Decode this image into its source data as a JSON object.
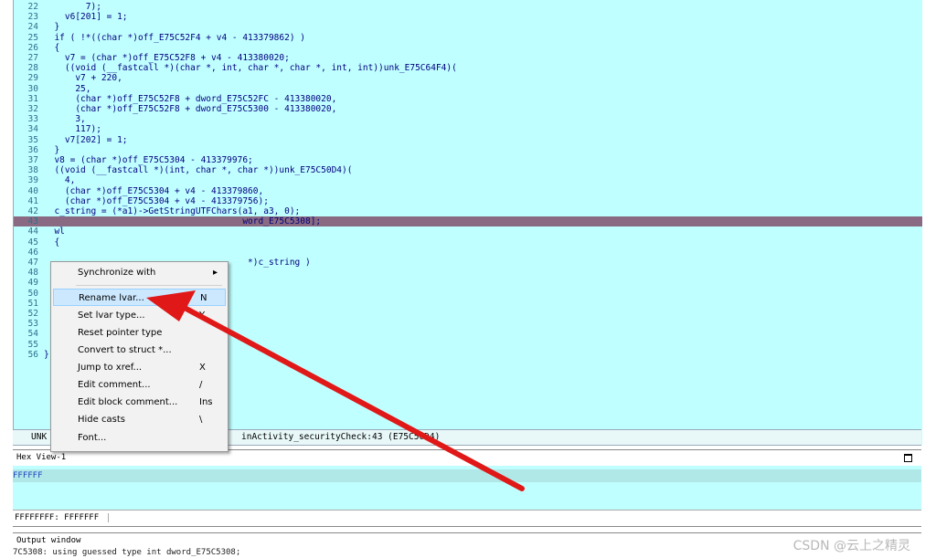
{
  "code_lines": [
    {
      "n": "22",
      "text": "        7);"
    },
    {
      "n": "23",
      "text": "    v6[201] = 1;"
    },
    {
      "n": "24",
      "text": "  }"
    },
    {
      "n": "25",
      "text": "  if ( !*((char *)off_E75C52F4 + v4 - 413379862) )"
    },
    {
      "n": "26",
      "text": "  {"
    },
    {
      "n": "27",
      "text": "    v7 = (char *)off_E75C52F8 + v4 - 413380020;"
    },
    {
      "n": "28",
      "text": "    ((void (__fastcall *)(char *, int, char *, char *, int, int))unk_E75C64F4)("
    },
    {
      "n": "29",
      "text": "      v7 + 220,"
    },
    {
      "n": "30",
      "text": "      25,"
    },
    {
      "n": "31",
      "text": "      (char *)off_E75C52F8 + dword_E75C52FC - 413380020,"
    },
    {
      "n": "32",
      "text": "      (char *)off_E75C52F8 + dword_E75C5300 - 413380020,"
    },
    {
      "n": "33",
      "text": "      3,"
    },
    {
      "n": "34",
      "text": "      117);"
    },
    {
      "n": "35",
      "text": "    v7[202] = 1;"
    },
    {
      "n": "36",
      "text": "  }"
    },
    {
      "n": "37",
      "text": "  v8 = (char *)off_E75C5304 - 413379976;"
    },
    {
      "n": "38",
      "text": "  ((void (__fastcall *)(int, char *, char *))unk_E75C50D4)("
    },
    {
      "n": "39",
      "text": "    4,"
    },
    {
      "n": "40",
      "text": "    (char *)off_E75C5304 + v4 - 413379860,"
    },
    {
      "n": "41",
      "text": "    (char *)off_E75C5304 + v4 - 413379756);"
    },
    {
      "n": "42",
      "text": "  c_string = (*a1)->GetStringUTFChars(a1, a3, 0);"
    },
    {
      "n": "43",
      "text": "                                      word_E75C5308];"
    },
    {
      "n": "44",
      "text": "  wl"
    },
    {
      "n": "45",
      "text": "  {"
    },
    {
      "n": "46",
      "text": ""
    },
    {
      "n": "47",
      "text": "                                       *)c_string )"
    },
    {
      "n": "48",
      "text": ""
    },
    {
      "n": "49",
      "text": ""
    },
    {
      "n": "50",
      "text": ""
    },
    {
      "n": "51",
      "text": ""
    },
    {
      "n": "52",
      "text": ""
    },
    {
      "n": "53",
      "text": ""
    },
    {
      "n": "54",
      "text": "  }"
    },
    {
      "n": "55",
      "text": "  re"
    },
    {
      "n": "56",
      "text": "}"
    }
  ],
  "status_bar": {
    "left": "UNK",
    "right": "inActivity_securityCheck:43 (E75C50D4)"
  },
  "context_menu": {
    "items": [
      {
        "label": "Synchronize with",
        "key": "▸"
      },
      {
        "label": "Rename lvar...",
        "key": "N"
      },
      {
        "label": "Set lvar type...",
        "key": "Y"
      },
      {
        "label": "Reset pointer type",
        "key": ""
      },
      {
        "label": "Convert to struct *...",
        "key": ""
      },
      {
        "label": "Jump to xref...",
        "key": "X"
      },
      {
        "label": "Edit comment...",
        "key": "/"
      },
      {
        "label": "Edit block comment...",
        "key": "Ins"
      },
      {
        "label": "Hide casts",
        "key": "\\"
      },
      {
        "label": "Font...",
        "key": ""
      }
    ],
    "selected_index": 1
  },
  "hex_view": {
    "title": "Hex View-1",
    "line1": "FFFFFF",
    "status": "FFFFFFFF: FFFFFFF"
  },
  "output_window": {
    "title": "Output window",
    "line": "7C5308: using guessed type int dword_E75C5308;"
  },
  "watermark": "CSDN @云上之精灵",
  "colors": {
    "code_bg": "#c0ffff",
    "highlight": "#8a6a82",
    "arrow": "#e01818",
    "menu_selected": "#cce8ff"
  }
}
